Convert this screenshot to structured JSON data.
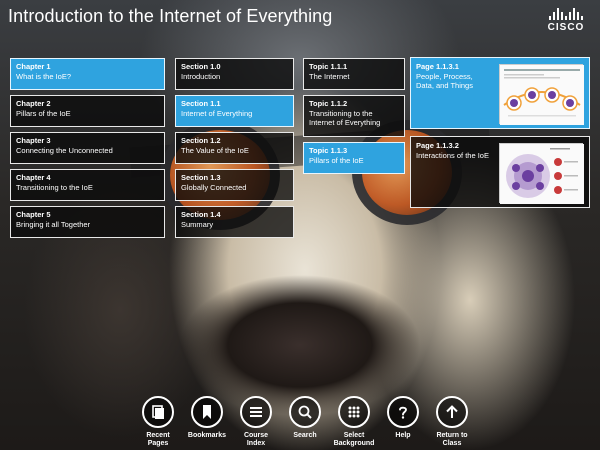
{
  "header": {
    "title": "Introduction to the Internet of Everything",
    "logo_text": "CISCO"
  },
  "chapters": [
    {
      "heading": "Chapter 1",
      "label": "What is the IoE?",
      "active": true
    },
    {
      "heading": "Chapter 2",
      "label": "Pillars of the IoE",
      "active": false
    },
    {
      "heading": "Chapter 3",
      "label": "Connecting the Unconnected",
      "active": false
    },
    {
      "heading": "Chapter 4",
      "label": "Transitioning to the IoE",
      "active": false
    },
    {
      "heading": "Chapter 5",
      "label": "Bringing it all Together",
      "active": false
    }
  ],
  "sections": [
    {
      "heading": "Section 1.0",
      "label": "Introduction",
      "active": false
    },
    {
      "heading": "Section 1.1",
      "label": "Internet of Everything",
      "active": true
    },
    {
      "heading": "Section 1.2",
      "label": "The Value of the IoE",
      "active": false
    },
    {
      "heading": "Section 1.3",
      "label": "Globally Connected",
      "active": false
    },
    {
      "heading": "Section 1.4",
      "label": "Summary",
      "active": false
    }
  ],
  "topics": [
    {
      "heading": "Topic 1.1.1",
      "label": "The Internet",
      "active": false
    },
    {
      "heading": "Topic 1.1.2",
      "label": "Transitioning to the Internet of Everything",
      "active": false
    },
    {
      "heading": "Topic 1.1.3",
      "label": "Pillars of the IoE",
      "active": true
    }
  ],
  "pages": [
    {
      "heading": "Page 1.1.3.1",
      "label": "People, Process, Data, and Things",
      "active": true
    },
    {
      "heading": "Page 1.1.3.2",
      "label": "Interactions of the IoE",
      "active": false
    }
  ],
  "toolbar": {
    "recent_pages": "Recent\nPages",
    "bookmarks": "Bookmarks",
    "course_index": "Course\nIndex",
    "search": "Search",
    "select_background": "Select\nBackground",
    "help": "Help",
    "return_to_class": "Return to\nClass"
  },
  "colors": {
    "accent": "#2fa3df",
    "card_bg": "#0a0a0a",
    "border": "#e8e8e8"
  }
}
